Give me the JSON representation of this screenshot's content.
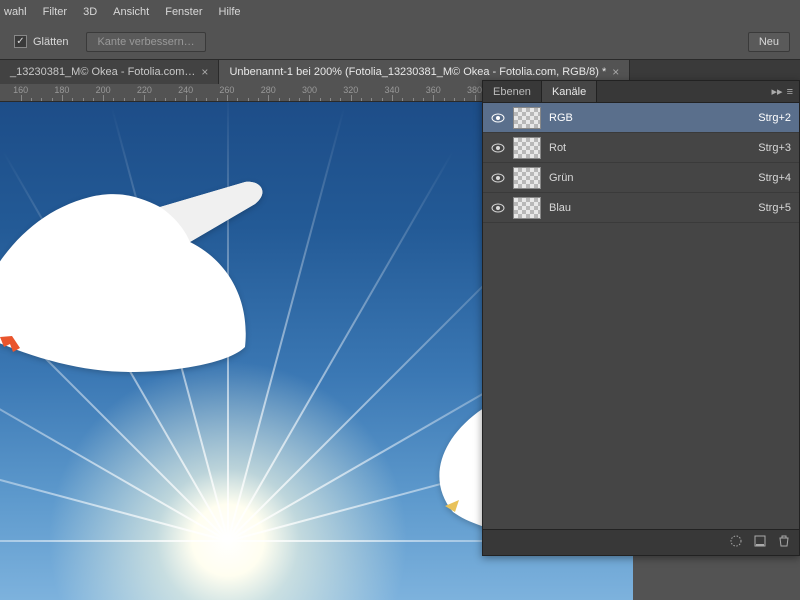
{
  "menubar": {
    "items": [
      "wahl",
      "Filter",
      "3D",
      "Ansicht",
      "Fenster",
      "Hilfe"
    ]
  },
  "options": {
    "smooth_label": "Glätten",
    "refine_edge_label": "Kante verbessern…",
    "new_button": "Neu"
  },
  "tabs": {
    "inactive_label": "_13230381_M© Okea - Fotolia.com…",
    "active_label": "Unbenannt-1 bei 200% (Fotolia_13230381_M© Okea - Fotolia.com, RGB/8) *"
  },
  "ruler": {
    "start": 160,
    "end": 520,
    "step": 20
  },
  "panel": {
    "tabs": [
      "Ebenen",
      "Kanäle"
    ],
    "channels": [
      {
        "name": "RGB",
        "shortcut": "Strg+2",
        "selected": true
      },
      {
        "name": "Rot",
        "shortcut": "Strg+3",
        "selected": false
      },
      {
        "name": "Grün",
        "shortcut": "Strg+4",
        "selected": false
      },
      {
        "name": "Blau",
        "shortcut": "Strg+5",
        "selected": false
      }
    ]
  }
}
